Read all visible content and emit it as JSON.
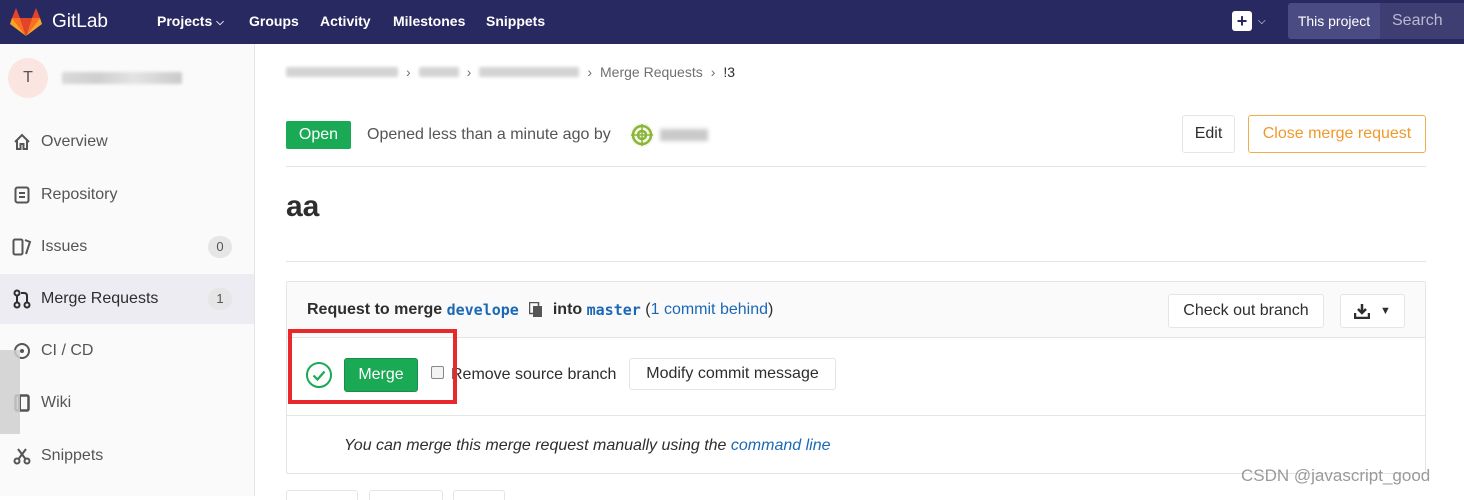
{
  "navbar": {
    "brand": "GitLab",
    "links": [
      {
        "label": "Projects",
        "has_dropdown": true
      },
      {
        "label": "Groups"
      },
      {
        "label": "Activity"
      },
      {
        "label": "Milestones"
      },
      {
        "label": "Snippets"
      }
    ],
    "scope": "This project",
    "search_placeholder": "Search"
  },
  "sidebar": {
    "project_avatar_letter": "T",
    "items": [
      {
        "label": "Overview",
        "icon": "home-icon"
      },
      {
        "label": "Repository",
        "icon": "repository-icon"
      },
      {
        "label": "Issues",
        "icon": "issues-icon",
        "count": "0"
      },
      {
        "label": "Merge Requests",
        "icon": "merge-request-icon",
        "count": "1",
        "active": true
      },
      {
        "label": "CI / CD",
        "icon": "rocket-icon"
      },
      {
        "label": "Wiki",
        "icon": "book-icon"
      },
      {
        "label": "Snippets",
        "icon": "scissors-icon"
      }
    ]
  },
  "breadcrumb": {
    "items": [
      "Merge Requests",
      "!3"
    ]
  },
  "mr": {
    "status": "Open",
    "opened_text": "Opened less than a minute ago by",
    "edit_label": "Edit",
    "close_label": "Close merge request",
    "title": "aa"
  },
  "widget": {
    "request_prefix": "Request to merge",
    "source_branch": "develope",
    "into_word": "into",
    "target_branch": "master",
    "behind_open": "(",
    "behind_link": "1 commit behind",
    "behind_close": ")",
    "checkout_label": "Check out branch",
    "merge_label": "Merge",
    "remove_source_label": "Remove source branch",
    "remove_source_checked": false,
    "modify_label": "Modify commit message",
    "manual_text": "You can merge this merge request manually using the",
    "manual_link": "command line"
  },
  "watermark": "CSDN @javascript_good",
  "colors": {
    "navbar_bg": "#292961",
    "open_green": "#1aaa55",
    "link_blue": "#1b69b6",
    "close_orange": "#f0992b",
    "highlight_red": "#e8282b"
  }
}
